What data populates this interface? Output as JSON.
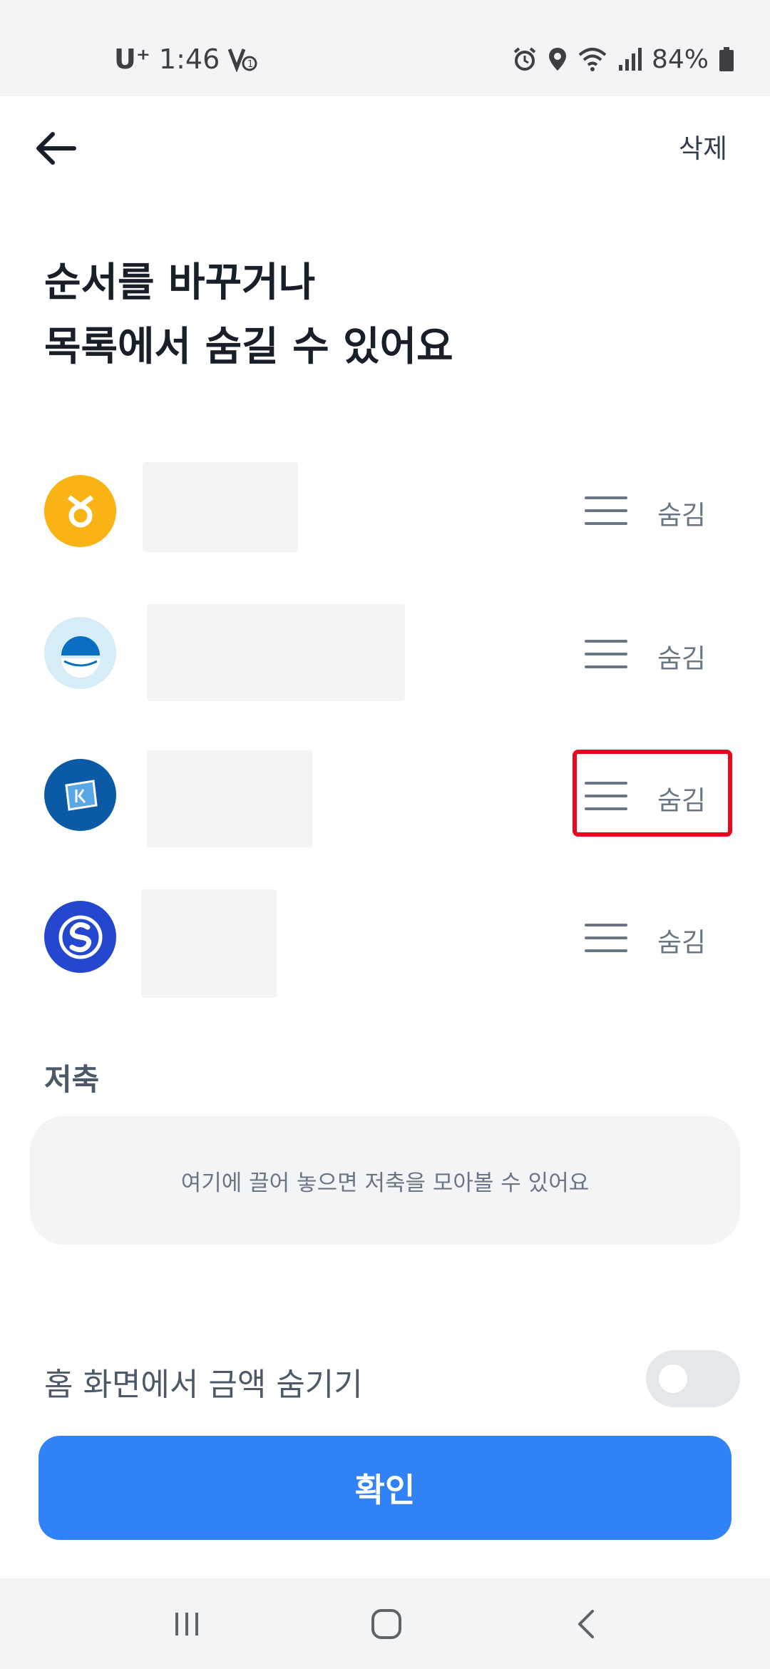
{
  "status_bar": {
    "carrier": "U⁺",
    "time": "1:46",
    "battery": "84%",
    "icons": [
      "volte-icon",
      "alarm-icon",
      "location-icon",
      "wifi-icon",
      "signal-icon",
      "battery-icon"
    ]
  },
  "header": {
    "back_icon": "arrow-left-icon",
    "delete_label": "삭제"
  },
  "title": {
    "line1": "순서를 바꾸거나",
    "line2": "목록에서 숨길 수 있어요"
  },
  "accounts": [
    {
      "logo": "kb-bank-logo",
      "logo_color": "#f9b315",
      "hide_label": "숨김"
    },
    {
      "logo": "woori-bank-logo",
      "logo_color": "#d6ecf7",
      "hide_label": "숨김"
    },
    {
      "logo": "ibk-bank-logo",
      "logo_color": "#0b5aa6",
      "hide_label": "숨김"
    },
    {
      "logo": "shinhan-bank-logo",
      "logo_color": "#2547d0",
      "hide_label": "숨김"
    }
  ],
  "savings": {
    "section_title": "저축",
    "drop_hint": "여기에 끌어 놓으면 저축을 모아볼 수 있어요"
  },
  "home_toggle": {
    "label": "홈 화면에서 금액 숨기기",
    "on": false
  },
  "confirm_label": "확인",
  "nav_bar": {
    "icons": [
      "recent-apps-icon",
      "home-icon",
      "back-icon"
    ]
  },
  "colors": {
    "accent": "#3182f6",
    "highlight": "#e8071e",
    "muted_bg": "#f2f4f6"
  }
}
